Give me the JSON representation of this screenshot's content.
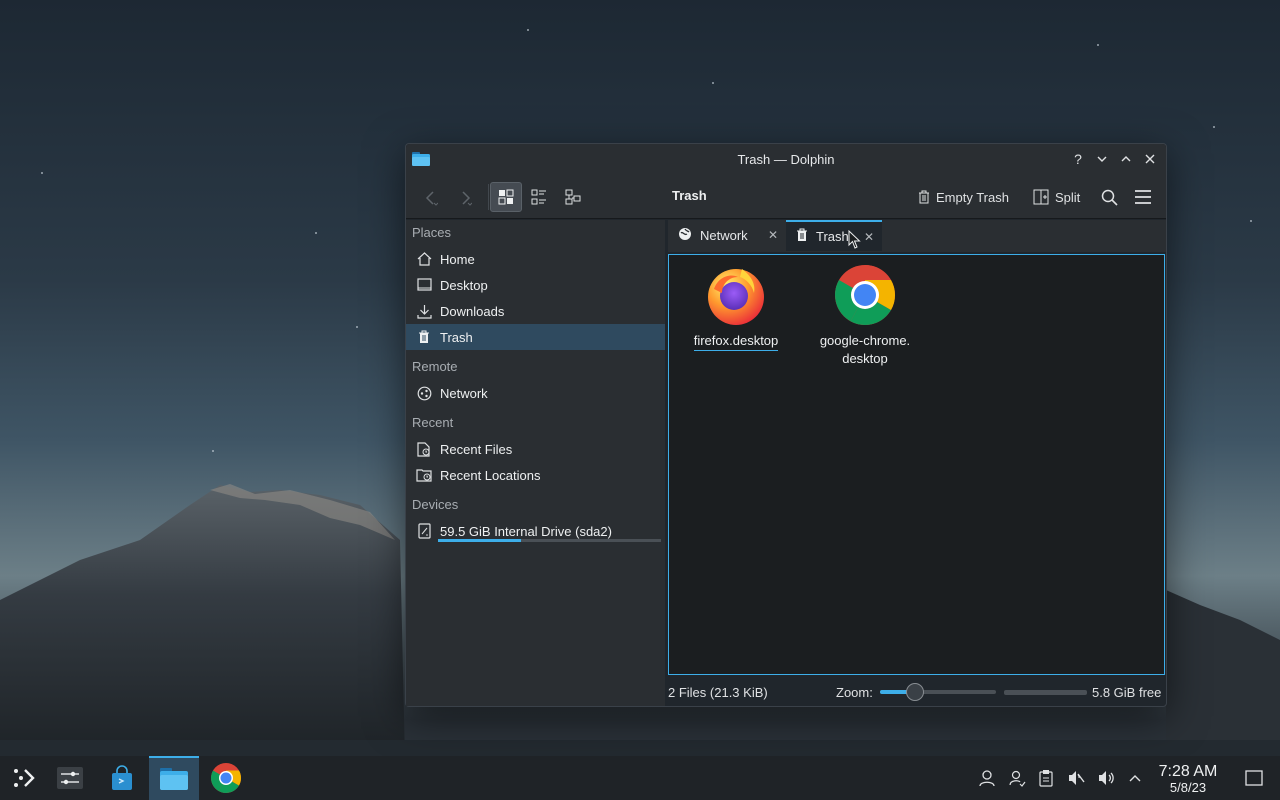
{
  "window": {
    "title": "Trash — Dolphin",
    "location": "Trash",
    "controls": [
      "?",
      "⌄",
      "⌃",
      "✕"
    ]
  },
  "toolbar": {
    "empty_trash": "Empty Trash",
    "split": "Split"
  },
  "sidebar": {
    "sections": [
      {
        "heading": "Places",
        "items": [
          {
            "label": "Home",
            "icon": "home-icon"
          },
          {
            "label": "Desktop",
            "icon": "desktop-icon"
          },
          {
            "label": "Downloads",
            "icon": "downloads-icon"
          },
          {
            "label": "Trash",
            "icon": "trash-icon",
            "active": true
          }
        ]
      },
      {
        "heading": "Remote",
        "items": [
          {
            "label": "Network",
            "icon": "network-icon"
          }
        ]
      },
      {
        "heading": "Recent",
        "items": [
          {
            "label": "Recent Files",
            "icon": "recent-files-icon"
          },
          {
            "label": "Recent Locations",
            "icon": "recent-locations-icon"
          }
        ]
      },
      {
        "heading": "Devices",
        "items": [
          {
            "label": "59.5 GiB Internal Drive (sda2)",
            "icon": "drive-icon",
            "usage_fraction": 0.37
          }
        ]
      }
    ]
  },
  "tabs": [
    {
      "label": "Network",
      "icon": "network-icon"
    },
    {
      "label": "Trash",
      "icon": "trash-icon",
      "active": true
    }
  ],
  "files": [
    {
      "name": "firefox.desktop",
      "icon": "firefox-icon"
    },
    {
      "name": "google-chrome.desktop",
      "name_line1": "google-chrome.",
      "name_line2": "desktop",
      "icon": "chrome-icon"
    }
  ],
  "status": {
    "summary": "2 Files (21.3 KiB)",
    "zoom_label": "Zoom:",
    "zoom_fraction": 0.3,
    "free_space": "5.8 GiB free"
  },
  "taskbar": {
    "time": "7:28 AM",
    "date": "5/8/23"
  },
  "colors": {
    "accent": "#3daee9",
    "window_bg": "#20262c",
    "panel_bg": "#2a2e32"
  }
}
